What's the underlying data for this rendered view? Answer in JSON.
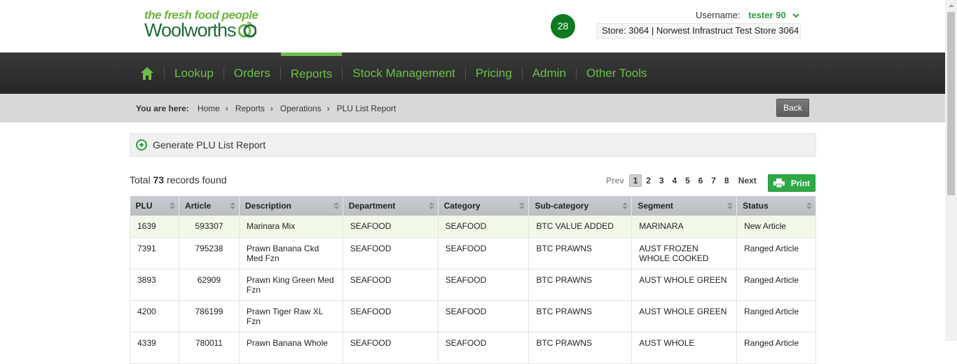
{
  "brand": {
    "tagline": "the fresh food people",
    "name": "Woolworths"
  },
  "header": {
    "notification_count": "28",
    "username_label": "Username:",
    "username": "tester 90",
    "store": "Store: 3064 | Norwest Infrastruct Test Store 3064"
  },
  "nav": {
    "items": [
      {
        "label": "Lookup"
      },
      {
        "label": "Orders"
      },
      {
        "label": "Reports",
        "active": true
      },
      {
        "label": "Stock Management"
      },
      {
        "label": "Pricing"
      },
      {
        "label": "Admin"
      },
      {
        "label": "Other Tools"
      }
    ]
  },
  "breadcrumb": {
    "lead": "You are here:",
    "items": [
      "Home",
      "Reports",
      "Operations",
      "PLU List Report"
    ]
  },
  "back_label": "Back",
  "generate_label": "Generate PLU List Report",
  "records": {
    "prefix": "Total",
    "count": "73",
    "suffix": "records found"
  },
  "pager": {
    "prev": "Prev",
    "pages": [
      "1",
      "2",
      "3",
      "4",
      "5",
      "6",
      "7",
      "8"
    ],
    "current": "1",
    "next": "Next"
  },
  "print_label": "Print",
  "colors": {
    "brand_green": "#6cc04a",
    "dark_green": "#1f6b3a",
    "badge_green": "#0c7a1f",
    "print_green": "#2ea845",
    "nav_bg": "#2e2e2e",
    "highlight_row": "#f0f9e8"
  },
  "table": {
    "columns": [
      "PLU",
      "Article",
      "Description",
      "Department",
      "Category",
      "Sub-category",
      "Segment",
      "Status"
    ],
    "rows": [
      [
        "1639",
        "593307",
        "Marinara Mix",
        "SEAFOOD",
        "SEAFOOD",
        "BTC VALUE ADDED",
        "MARINARA",
        "New Article"
      ],
      [
        "7391",
        "795238",
        "Prawn Banana Ckd Med Fzn",
        "SEAFOOD",
        "SEAFOOD",
        "BTC PRAWNS",
        "AUST FROZEN WHOLE COOKED",
        "Ranged Article"
      ],
      [
        "3893",
        "62909",
        "Prawn King Green Med Fzn",
        "SEAFOOD",
        "SEAFOOD",
        "BTC PRAWNS",
        "AUST WHOLE GREEN",
        "Ranged Article"
      ],
      [
        "4200",
        "786199",
        "Prawn Tiger Raw XL Fzn",
        "SEAFOOD",
        "SEAFOOD",
        "BTC PRAWNS",
        "AUST WHOLE GREEN",
        "Ranged Article"
      ],
      [
        "4339",
        "780011",
        "Prawn Banana Whole",
        "SEAFOOD",
        "SEAFOOD",
        "BTC PRAWNS",
        "AUST WHOLE",
        "Ranged Article"
      ]
    ]
  }
}
